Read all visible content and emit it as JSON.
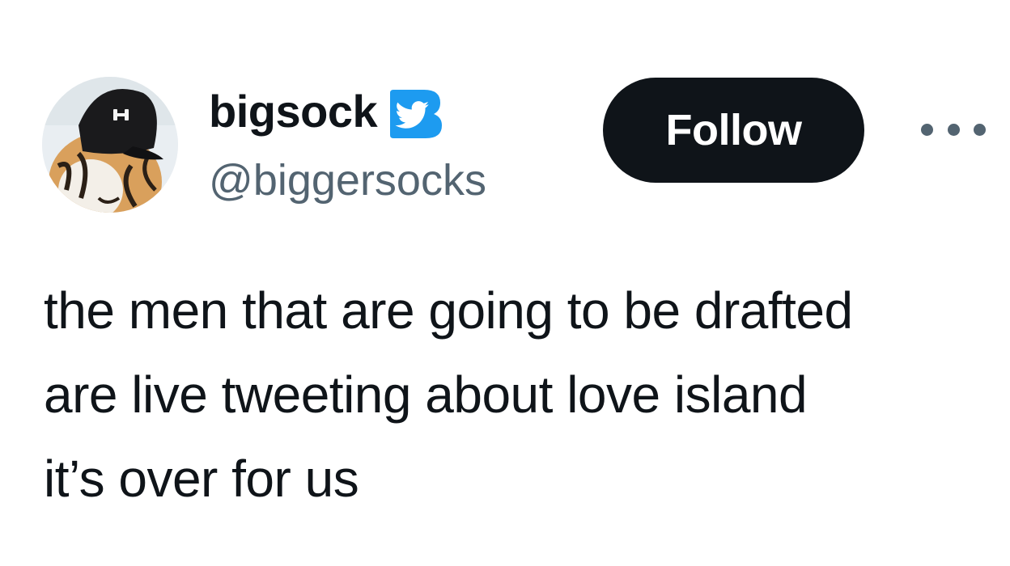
{
  "tweet": {
    "author": {
      "display_name": "bigsock",
      "handle": "@biggersocks",
      "verified_badge_icon": "verified-bird-badge-icon",
      "avatar_icon": "tiger-in-cap-avatar"
    },
    "follow_label": "Follow",
    "more_icon": "more-options-icon",
    "text_lines": [
      "the men that are going to be drafted",
      "are live tweeting about love island",
      "it’s over for us"
    ]
  },
  "colors": {
    "text_primary": "#0f1419",
    "text_secondary": "#536471",
    "follow_button_bg": "#0f1419",
    "follow_button_text": "#ffffff",
    "verified_badge": "#1d9bf0",
    "background": "#ffffff"
  }
}
